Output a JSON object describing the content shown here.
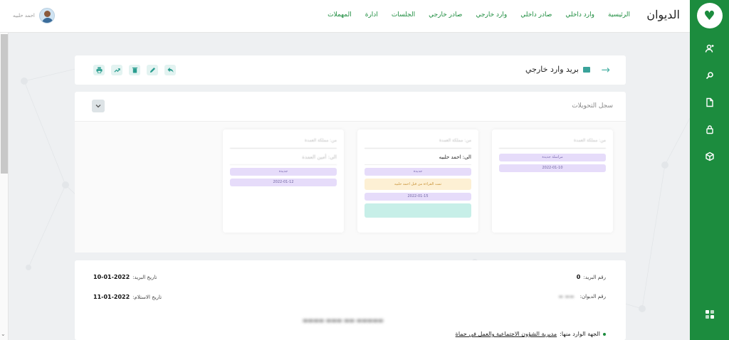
{
  "app": {
    "brand": "الديوان"
  },
  "topnav": {
    "items": [
      "الرئيسية",
      "وارد داخلي",
      "صادر داخلي",
      "وارد خارجي",
      "صادر خارجي",
      "الجلسات",
      "ادارة",
      "المهملات"
    ]
  },
  "user": {
    "name": "احمد حلبيه"
  },
  "header": {
    "title": "بريد وارد خارجي"
  },
  "transfers": {
    "title": "سجل التحويلات",
    "columns": [
      {
        "from": "من: مملكة العمدة",
        "to": "",
        "to_blurred": false,
        "pills": [
          {
            "text": "مراسلة جديدة",
            "kind": "purple"
          },
          {
            "text": "2022-01-10",
            "kind": "date"
          }
        ]
      },
      {
        "from": "من: مملكة العمدة",
        "to": "الى: احمد حلبيه",
        "to_blurred": false,
        "pills": [
          {
            "text": "جديدة",
            "kind": "purple"
          },
          {
            "text": "تمت القراءة من قبل احمد حلبيه",
            "kind": "orange"
          },
          {
            "text": "2022-01-15",
            "kind": "date"
          },
          {
            "text": "",
            "kind": "teal"
          }
        ]
      },
      {
        "from": "من: مملكة العمدة",
        "to": "الى: أمين العمدة",
        "to_blurred": true,
        "pills": [
          {
            "text": "جديدة",
            "kind": "purple"
          },
          {
            "text": "2022-01-12",
            "kind": "date"
          }
        ]
      }
    ]
  },
  "info": {
    "mail_number_label": "رقم البريد:",
    "mail_number": "0",
    "diwan_number_label": "رقم الديوان:",
    "diwan_number": "",
    "mail_date_label": "تاريخ البريد:",
    "mail_date": "10-01-2022",
    "receipt_date_label": "تاريخ الاستلام:",
    "receipt_date": "11-01-2022",
    "source_label": "الجهة الوارد منها:",
    "source_value": "مديرية الشؤون الاجتماعية والعمل في حماة"
  }
}
